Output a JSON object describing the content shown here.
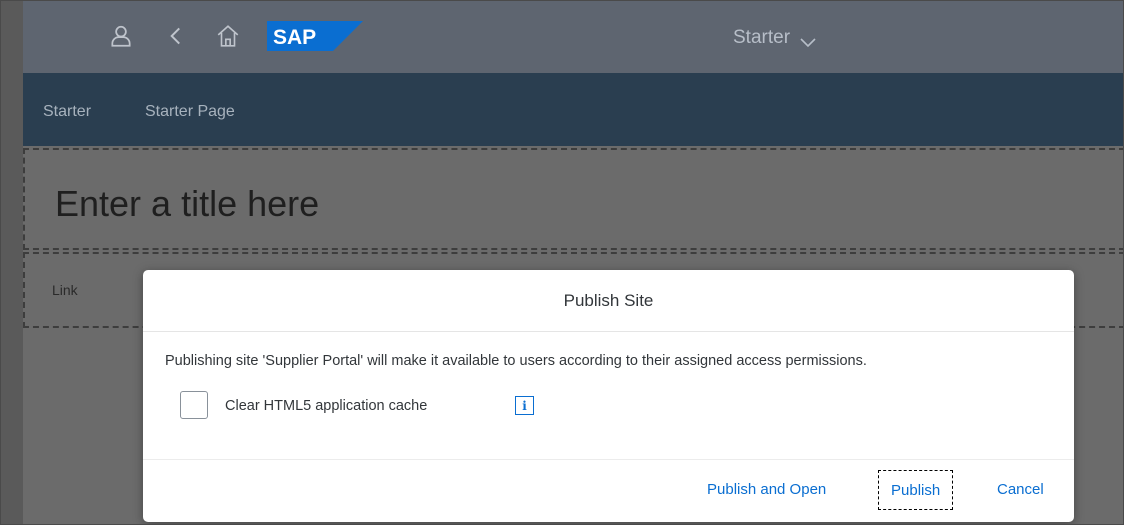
{
  "shell": {
    "icons": [
      "user-icon",
      "back-icon",
      "home-icon"
    ],
    "logo_text": "SAP",
    "site_title": "Starter"
  },
  "nav": {
    "items": [
      {
        "label": "Starter"
      },
      {
        "label": "Starter Page"
      }
    ]
  },
  "page": {
    "title_placeholder": "Enter a title here",
    "link_text": "Link"
  },
  "dialog": {
    "title": "Publish Site",
    "message": "Publishing site 'Supplier Portal' will make it available to users according to their assigned access permissions.",
    "checkbox_label": "Clear HTML5 application cache",
    "checkbox_checked": false,
    "info_glyph": "i",
    "buttons": {
      "publish_open": "Publish and Open",
      "publish": "Publish",
      "cancel": "Cancel"
    }
  },
  "colors": {
    "shell_bg": "#5e6570",
    "nav_bg": "#2a3e50",
    "accent": "#0a6ed1",
    "sap_blue": "#0a6ed1"
  }
}
